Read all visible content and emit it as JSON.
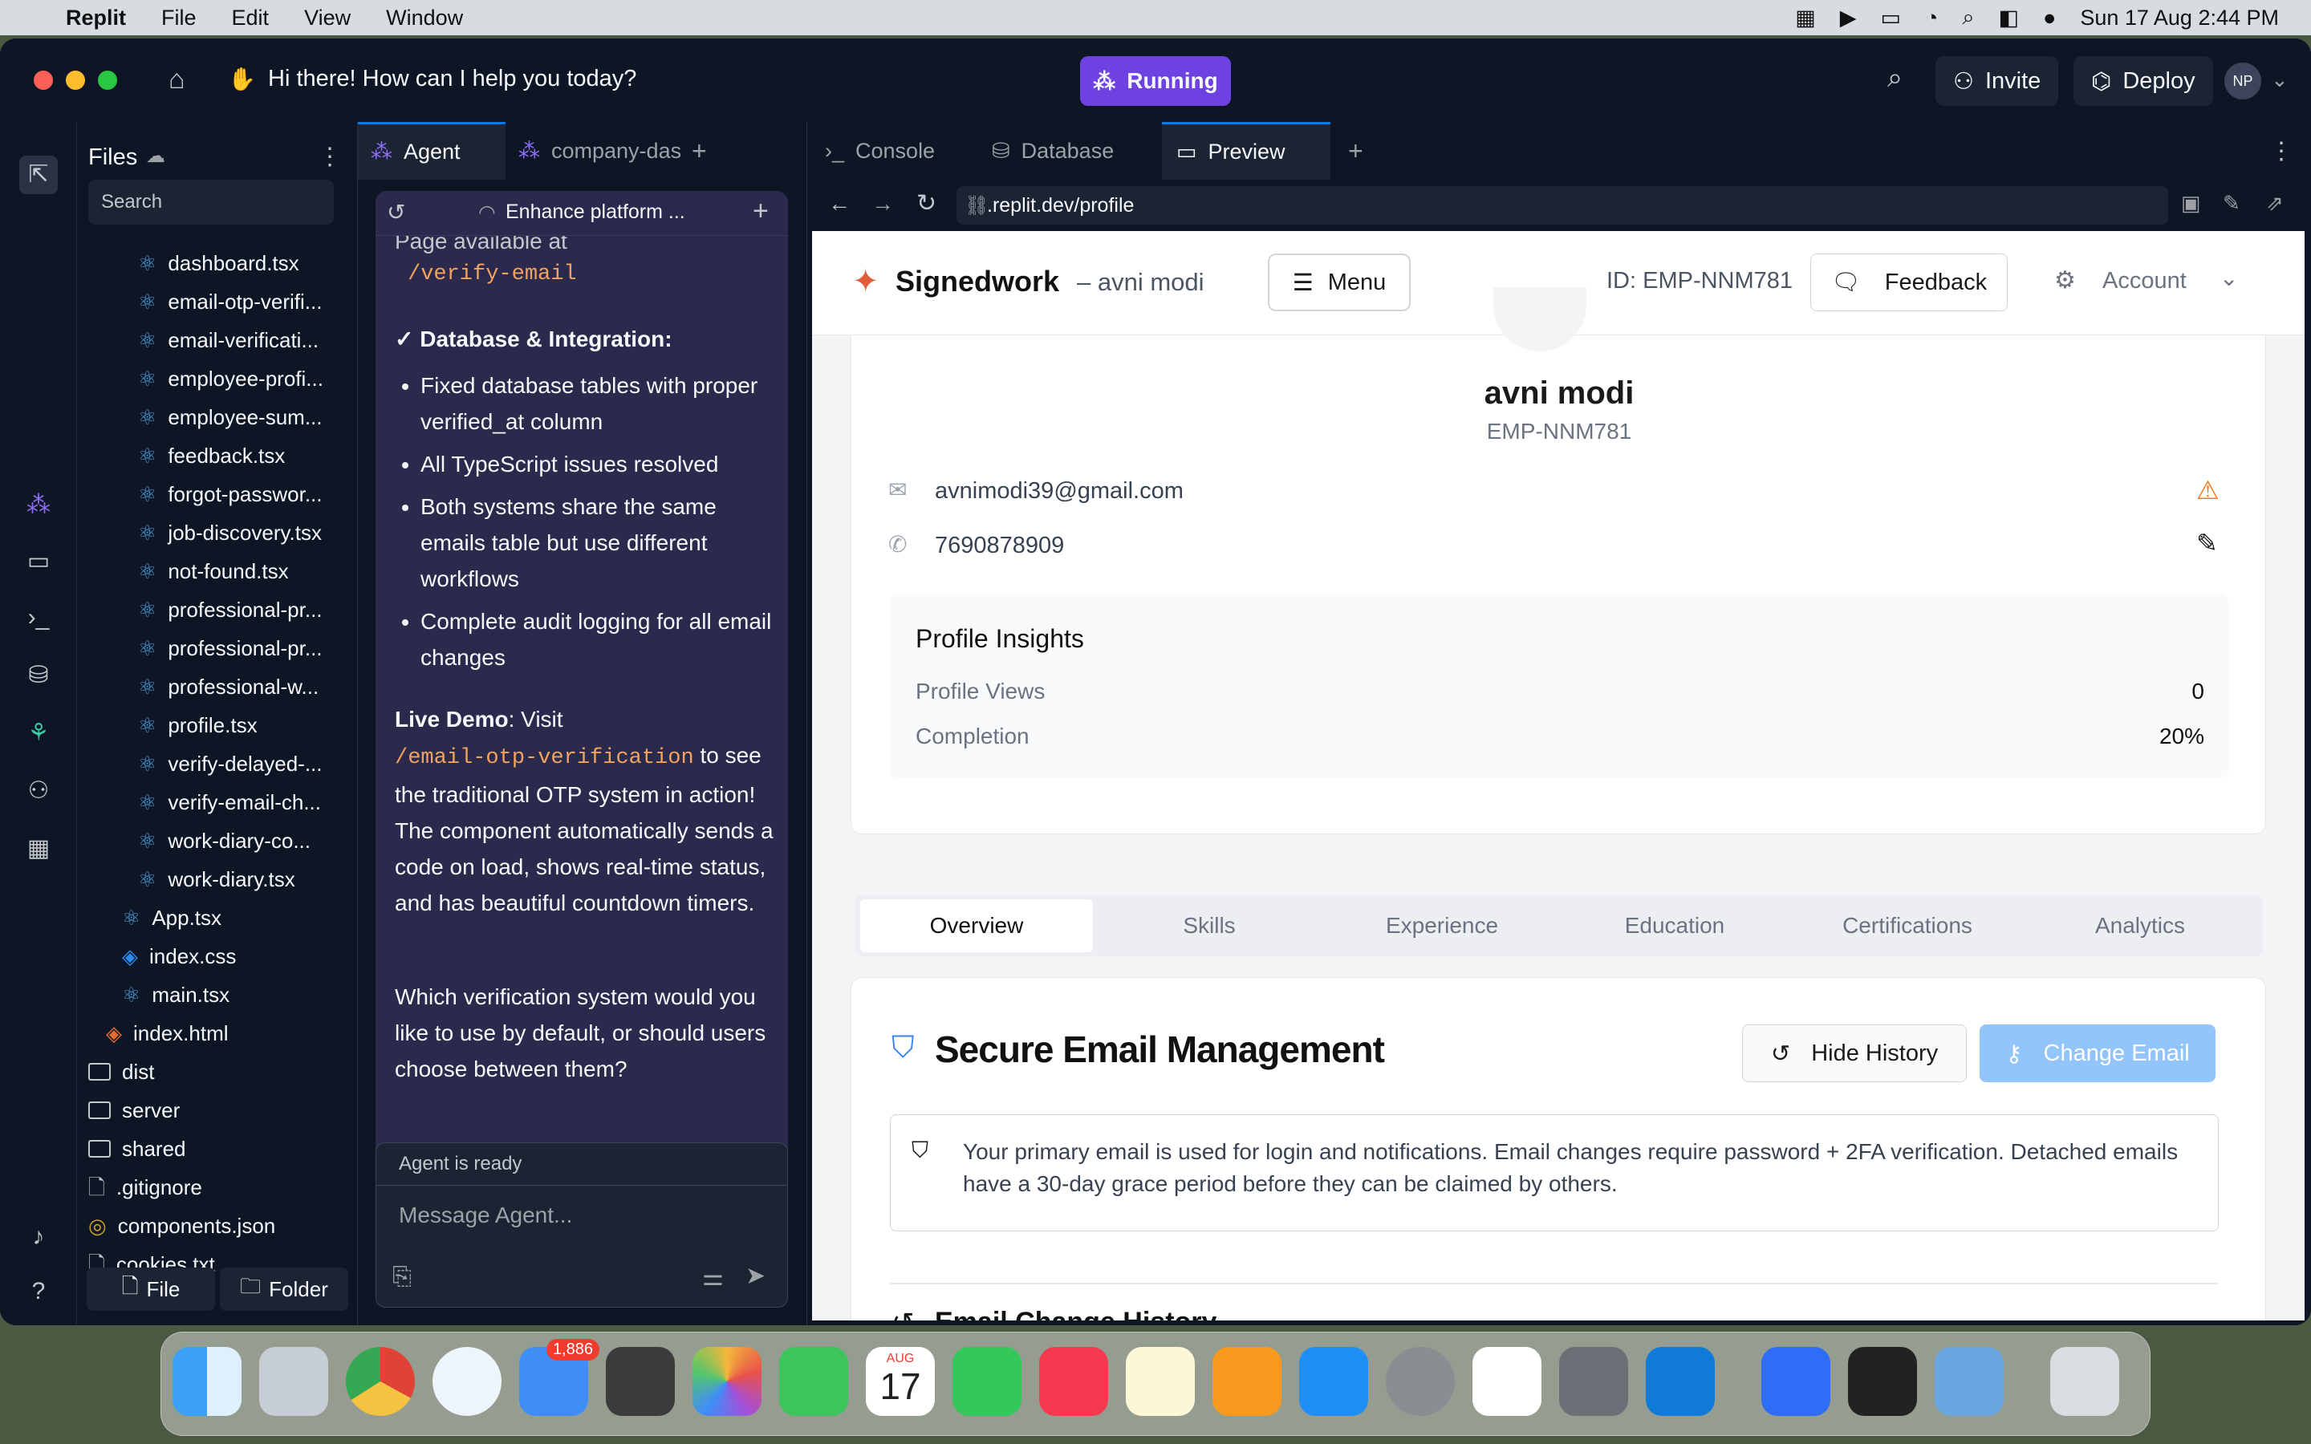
{
  "menubar": {
    "app": "Replit",
    "items": [
      "File",
      "Edit",
      "View",
      "Window"
    ],
    "datetime": "Sun 17 Aug  2:44 PM"
  },
  "titlebar": {
    "prompt": "Hi there! How can I help you today?",
    "running": "Running",
    "invite": "Invite",
    "deploy": "Deploy",
    "avatar": "NP"
  },
  "files": {
    "title": "Files",
    "search_placeholder": "Search",
    "items": [
      {
        "name": "dashboard.tsx",
        "type": "react",
        "indent": 2
      },
      {
        "name": "email-otp-verifi...",
        "type": "react",
        "indent": 2
      },
      {
        "name": "email-verificati...",
        "type": "react",
        "indent": 2
      },
      {
        "name": "employee-profi...",
        "type": "react",
        "indent": 2
      },
      {
        "name": "employee-sum...",
        "type": "react",
        "indent": 2
      },
      {
        "name": "feedback.tsx",
        "type": "react",
        "indent": 2
      },
      {
        "name": "forgot-passwor...",
        "type": "react",
        "indent": 2
      },
      {
        "name": "job-discovery.tsx",
        "type": "react",
        "indent": 2
      },
      {
        "name": "not-found.tsx",
        "type": "react",
        "indent": 2
      },
      {
        "name": "professional-pr...",
        "type": "react",
        "indent": 2
      },
      {
        "name": "professional-pr...",
        "type": "react",
        "indent": 2
      },
      {
        "name": "professional-w...",
        "type": "react",
        "indent": 2
      },
      {
        "name": "profile.tsx",
        "type": "react",
        "indent": 2
      },
      {
        "name": "verify-delayed-...",
        "type": "react",
        "indent": 2
      },
      {
        "name": "verify-email-ch...",
        "type": "react",
        "indent": 2
      },
      {
        "name": "work-diary-co...",
        "type": "react",
        "indent": 2
      },
      {
        "name": "work-diary.tsx",
        "type": "react",
        "indent": 2
      },
      {
        "name": "App.tsx",
        "type": "react",
        "indent": 1
      },
      {
        "name": "index.css",
        "type": "css",
        "indent": 1
      },
      {
        "name": "main.tsx",
        "type": "react",
        "indent": 1
      },
      {
        "name": "index.html",
        "type": "html",
        "indent": 0
      },
      {
        "name": "dist",
        "type": "folder",
        "indent": -1
      },
      {
        "name": "server",
        "type": "folder",
        "indent": -1
      },
      {
        "name": "shared",
        "type": "folder",
        "indent": -1
      },
      {
        "name": ".gitignore",
        "type": "file",
        "indent": -1
      },
      {
        "name": "components.json",
        "type": "json",
        "indent": -1
      },
      {
        "name": "cookies.txt",
        "type": "text",
        "indent": -1
      }
    ],
    "new_file": "File",
    "new_folder": "Folder"
  },
  "agent": {
    "tab_agent": "Agent",
    "tab_other": "company-das",
    "thread_title": "Enhance platform ...",
    "page_available": "Page available at",
    "verify_path": "/verify-email",
    "db_heading": "✓ Database & Integration:",
    "bullets": [
      "Fixed database tables with proper verified_at column",
      "All TypeScript issues resolved",
      "Both systems share the same emails table but use different workflows",
      "Complete audit logging for all email changes"
    ],
    "demo_label": "Live Demo",
    "demo_pre": ": Visit",
    "demo_path": "/email-otp-verification",
    "demo_post": "to see the traditional OTP system in action! The component automatically sends a code on load, shows real-time status, and has beautiful countdown timers.",
    "question": "Which verification system would you like to use by default, or should users choose between them?",
    "status": "Agent is ready",
    "input_placeholder": "Message Agent..."
  },
  "right_tabs": {
    "console": "Console",
    "database": "Database",
    "preview": "Preview",
    "url": ".replit.dev/profile"
  },
  "app": {
    "brand": "Signedwork",
    "brand_sub": "– avni modi",
    "menu": "Menu",
    "id": "ID: EMP-NNM781",
    "feedback": "Feedback",
    "account": "Account",
    "name": "avni modi",
    "emp_id": "EMP-NNM781",
    "email": "avnimodi39@gmail.com",
    "phone": "7690878909",
    "insights_title": "Profile Insights",
    "views_label": "Profile Views",
    "views_value": "0",
    "completion_label": "Completion",
    "completion_value": "20%",
    "tabs": [
      "Overview",
      "Skills",
      "Experience",
      "Education",
      "Certifications",
      "Analytics"
    ],
    "secure_title": "Secure Email Management",
    "hide_history": "Hide History",
    "change_email": "Change Email",
    "notice": "Your primary email is used for login and notifications. Email changes require password + 2FA verification. Detached emails have a 30-day grace period before they can be claimed by others.",
    "history_title": "Email Change History"
  },
  "dock": {
    "mail_badge": "1,886",
    "cal_month": "AUG",
    "cal_day": "17"
  },
  "colors": {
    "accent": "#6e42e0",
    "primary_btn": "#93c5fd",
    "warning": "#f97316"
  }
}
